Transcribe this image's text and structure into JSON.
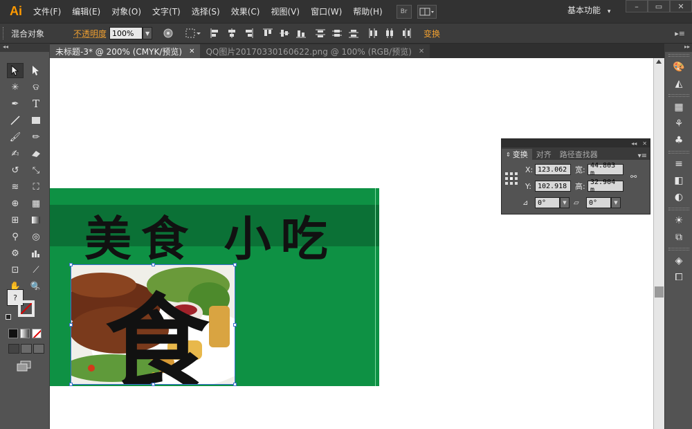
{
  "app": {
    "logo": "Ai",
    "menus": [
      "文件(F)",
      "编辑(E)",
      "对象(O)",
      "文字(T)",
      "选择(S)",
      "效果(C)",
      "视图(V)",
      "窗口(W)",
      "帮助(H)"
    ],
    "bridge_label": "Br",
    "workspace": "基本功能",
    "workspace_caret": "▾",
    "win_buttons": [
      "–",
      "▭",
      "✕"
    ]
  },
  "control_bar": {
    "object_type": "混合对象",
    "opacity_label": "不透明度",
    "opacity_value": "100%",
    "transform_link": "变换"
  },
  "doc_tabs": [
    {
      "label": "未标题-3* @ 200% (CMYK/预览)",
      "active": true
    },
    {
      "label": "QQ图片20170330160622.png @ 100% (RGB/预览)",
      "active": false
    }
  ],
  "tab_close": "✕",
  "artwork": {
    "banner_title": "美食 小吃",
    "food_char": "食",
    "banner_color": "#0e9144",
    "band_color": "#0b7136"
  },
  "transform_panel": {
    "tabs": [
      "变换",
      "对齐",
      "路径查找器"
    ],
    "x_label": "X:",
    "x_value": "123.062",
    "y_label": "Y:",
    "y_value": "102.918",
    "w_label": "宽:",
    "w_value": "44.803 m",
    "h_label": "高:",
    "h_value": "32.904 m",
    "rotate_value": "0°",
    "shear_value": "0°"
  },
  "toolbar": {
    "tools": [
      "selection-tool",
      "direct-selection-tool",
      "magic-wand-tool",
      "lasso-tool",
      "pen-tool",
      "type-tool",
      "line-tool",
      "rectangle-tool",
      "paintbrush-tool",
      "pencil-tool",
      "blob-brush-tool",
      "eraser-tool",
      "rotate-tool",
      "scale-tool",
      "warp-tool",
      "free-transform-tool",
      "shape-builder-tool",
      "perspective-grid-tool",
      "mesh-tool",
      "gradient-tool",
      "eyedropper-tool",
      "blend-tool",
      "symbol-sprayer-tool",
      "column-graph-tool",
      "artboard-tool",
      "slice-tool",
      "hand-tool",
      "zoom-tool"
    ],
    "stroke_question": "?"
  }
}
